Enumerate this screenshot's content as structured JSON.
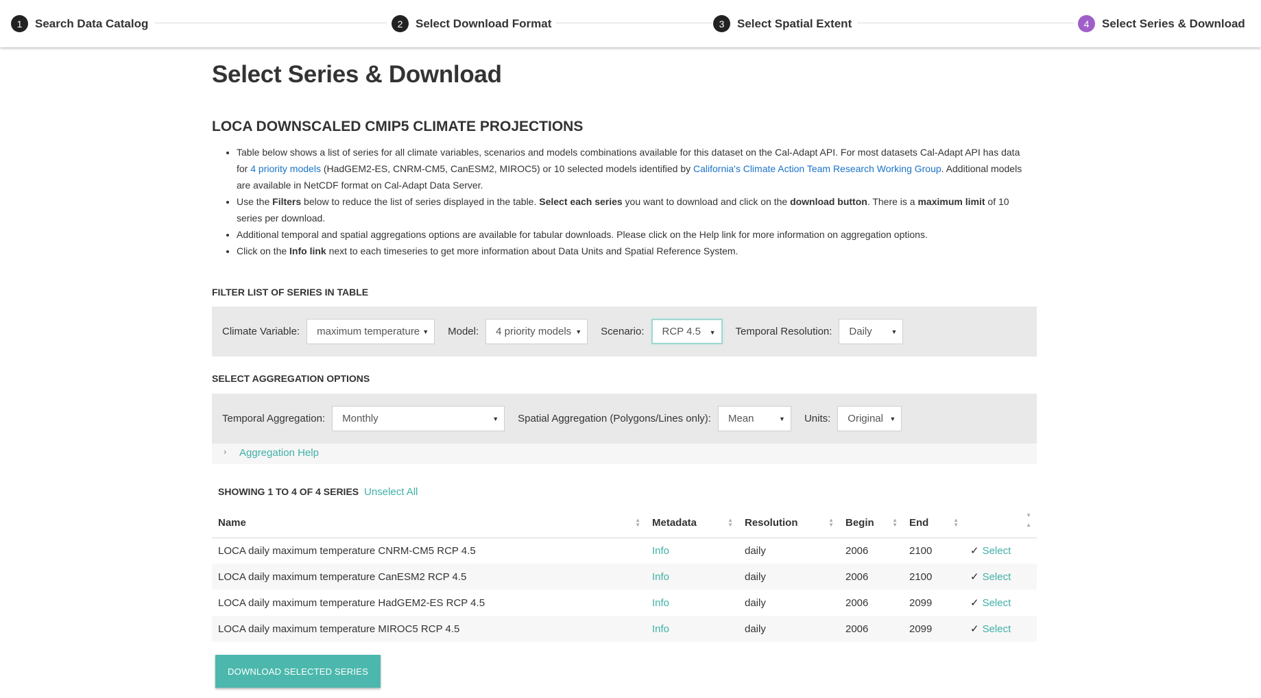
{
  "stepper": {
    "steps": [
      {
        "num": "1",
        "label": "Search Data Catalog"
      },
      {
        "num": "2",
        "label": "Select Download Format"
      },
      {
        "num": "3",
        "label": "Select Spatial Extent"
      },
      {
        "num": "4",
        "label": "Select Series & Download"
      }
    ],
    "active_color": "#a05fc8"
  },
  "page": {
    "title": "Select Series & Download",
    "dataset_title": "LOCA DOWNSCALED CMIP5 CLIMATE PROJECTIONS"
  },
  "notes": {
    "n1_a": "Table below shows a list of series for all climate variables, scenarios and models combinations available for this dataset on the Cal-Adapt API. For most datasets Cal-Adapt API has data for ",
    "n1_link1": "4 priority models",
    "n1_b": " (HadGEM2-ES, CNRM-CM5, CanESM2, MIROC5) or 10 selected models identified by ",
    "n1_link2": "California's Climate Action Team Research Working Group",
    "n1_c": ". Additional models are available in NetCDF format on Cal-Adapt Data Server.",
    "n2_a": "Use the ",
    "n2_b1": "Filters",
    "n2_c": " below to reduce the list of series displayed in the table. ",
    "n2_b2": "Select each series",
    "n2_d": " you want to download and click on the ",
    "n2_b3": "download button",
    "n2_e": ". There is a ",
    "n2_b4": "maximum limit",
    "n2_f": " of 10 series per download.",
    "n3": "Additional temporal and spatial aggregations options are available for tabular downloads. Please click on the Help link for more information on aggregation options.",
    "n4_a": "Click on the ",
    "n4_b": "Info link",
    "n4_c": " next to each timeseries to get more information about Data Units and Spatial Reference System."
  },
  "filters": {
    "heading": "FILTER LIST OF SERIES IN TABLE",
    "climate_variable_label": "Climate Variable:",
    "climate_variable_value": "maximum temperature",
    "model_label": "Model:",
    "model_value": "4 priority models",
    "scenario_label": "Scenario:",
    "scenario_value": "RCP 4.5",
    "temporal_resolution_label": "Temporal Resolution:",
    "temporal_resolution_value": "Daily"
  },
  "aggregation": {
    "heading": "SELECT AGGREGATION OPTIONS",
    "temporal_label": "Temporal Aggregation:",
    "temporal_value": "Monthly",
    "spatial_label": "Spatial Aggregation (Polygons/Lines only):",
    "spatial_value": "Mean",
    "units_label": "Units:",
    "units_value": "Original",
    "help_link": "Aggregation Help"
  },
  "table": {
    "showing": "SHOWING 1 TO 4 OF 4 SERIES",
    "unselect_all": "Unselect All",
    "columns": [
      "Name",
      "Metadata",
      "Resolution",
      "Begin",
      "End",
      ""
    ],
    "rows": [
      {
        "name": "LOCA daily maximum temperature CNRM-CM5 RCP 4.5",
        "metadata": "Info",
        "resolution": "daily",
        "begin": "2006",
        "end": "2100",
        "check": "✓",
        "action": "Select"
      },
      {
        "name": "LOCA daily maximum temperature CanESM2 RCP 4.5",
        "metadata": "Info",
        "resolution": "daily",
        "begin": "2006",
        "end": "2100",
        "check": "✓",
        "action": "Select"
      },
      {
        "name": "LOCA daily maximum temperature HadGEM2-ES RCP 4.5",
        "metadata": "Info",
        "resolution": "daily",
        "begin": "2006",
        "end": "2099",
        "check": "✓",
        "action": "Select"
      },
      {
        "name": "LOCA daily maximum temperature MIROC5 RCP 4.5",
        "metadata": "Info",
        "resolution": "daily",
        "begin": "2006",
        "end": "2099",
        "check": "✓",
        "action": "Select"
      }
    ]
  },
  "download_button": "DOWNLOAD SELECTED SERIES",
  "colors": {
    "accent": "#4cb8ad",
    "link": "#1a73c8",
    "teal_link": "#3fb0a6"
  }
}
